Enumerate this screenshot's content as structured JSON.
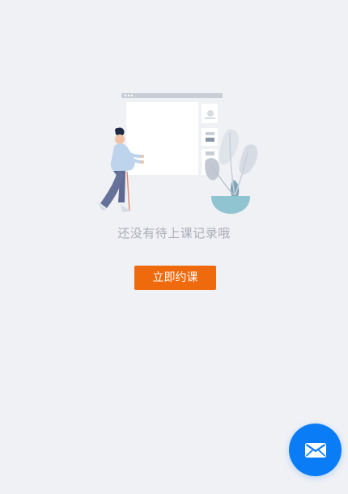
{
  "empty_state": {
    "message": "还没有待上课记录哦",
    "illustration_icon": "empty-schedule-illustration"
  },
  "actions": {
    "book_label": "立即约课"
  },
  "floating_action": {
    "icon": "envelope-icon",
    "color": "#0a7cf6"
  },
  "colors": {
    "background": "#f0f1f5",
    "accent": "#ee6a0c",
    "message_text": "#a9adb5"
  }
}
